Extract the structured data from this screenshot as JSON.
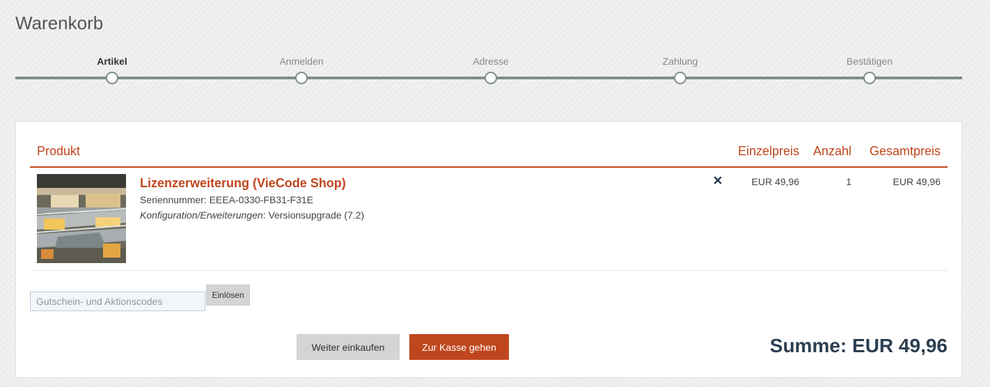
{
  "page": {
    "title": "Warenkorb"
  },
  "steps": [
    {
      "label": "Artikel",
      "active": true
    },
    {
      "label": "Anmelden",
      "active": false
    },
    {
      "label": "Adresse",
      "active": false
    },
    {
      "label": "Zahlung",
      "active": false
    },
    {
      "label": "Bestätigen",
      "active": false
    }
  ],
  "cart": {
    "headers": {
      "product": "Produkt",
      "unit_price": "Einzelpreis",
      "quantity": "Anzahl",
      "total_price": "Gesamtpreis"
    },
    "items": [
      {
        "name": "Lizenzerweiterung (VieCode Shop)",
        "serial": "Seriennummer: EEEA-0330-FB31-F31E",
        "config_label": "Konfiguration/Erweiterungen",
        "config_value": ": Versionsupgrade (7.2)",
        "unit_price": "EUR 49,96",
        "quantity": "1",
        "total_price": "EUR 49,96",
        "remove_icon": "close-icon"
      }
    ]
  },
  "coupon": {
    "placeholder": "Gutschein- und Aktionscodes",
    "value": "",
    "redeem_label": "Einlösen"
  },
  "actions": {
    "continue_label": "Weiter einkaufen",
    "checkout_label": "Zur Kasse gehen"
  },
  "summary": {
    "text": "Summe: EUR 49,96"
  },
  "colors": {
    "accent": "#c0461d",
    "progress": "#7f8c8d",
    "sum_text": "#2c3e50"
  }
}
